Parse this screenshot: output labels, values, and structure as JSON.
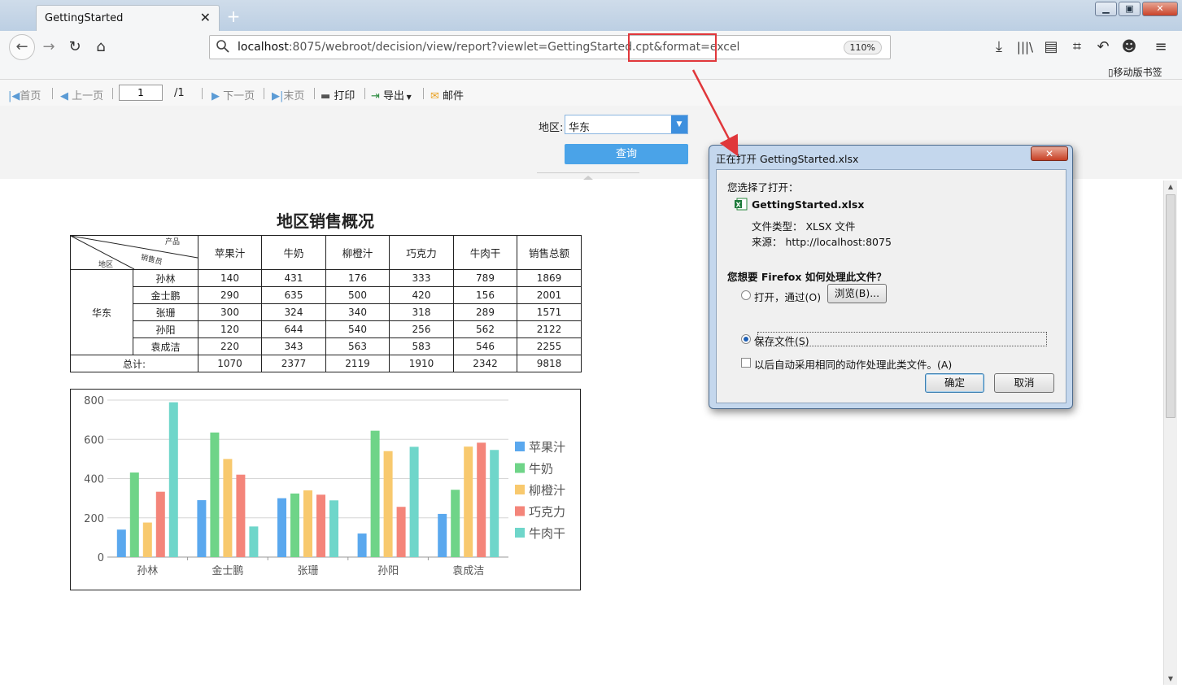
{
  "browser": {
    "tab_title": "GettingStarted",
    "url_host": "localhost",
    "url_rest": ":8075/webroot/decision/view/report?viewlet=GettingStarted.cpt&format=excel",
    "zoom": "110%",
    "mobile_bookmarks": "移动版书签"
  },
  "toolbar": {
    "first": "首页",
    "prev": "上一页",
    "page_value": "1",
    "page_total": "/1",
    "next": "下一页",
    "last": "末页",
    "print": "打印",
    "export": "导出",
    "mail": "邮件"
  },
  "params": {
    "region_label": "地区:",
    "region_value": "华东",
    "query_label": "查询"
  },
  "report": {
    "title": "地区销售概况",
    "corner": {
      "product": "产品",
      "salesperson": "销售员",
      "region": "地区"
    },
    "columns": [
      "苹果汁",
      "牛奶",
      "柳橙汁",
      "巧克力",
      "牛肉干",
      "销售总额"
    ],
    "region": "华东",
    "rows": [
      {
        "name": "孙林",
        "values": [
          "140",
          "431",
          "176",
          "333",
          "789",
          "1869"
        ]
      },
      {
        "name": "金士鹏",
        "values": [
          "290",
          "635",
          "500",
          "420",
          "156",
          "2001"
        ]
      },
      {
        "name": "张珊",
        "values": [
          "300",
          "324",
          "340",
          "318",
          "289",
          "1571"
        ]
      },
      {
        "name": "孙阳",
        "values": [
          "120",
          "644",
          "540",
          "256",
          "562",
          "2122"
        ]
      },
      {
        "name": "袁成洁",
        "values": [
          "220",
          "343",
          "563",
          "583",
          "546",
          "2255"
        ]
      }
    ],
    "total_label": "总计:",
    "totals": [
      "1070",
      "2377",
      "2119",
      "1910",
      "2342",
      "9818"
    ]
  },
  "chart_data": {
    "type": "bar",
    "categories": [
      "孙林",
      "金士鹏",
      "张珊",
      "孙阳",
      "袁成洁"
    ],
    "series": [
      {
        "name": "苹果汁",
        "values": [
          140,
          290,
          300,
          120,
          220
        ],
        "color": "#5aa8ee"
      },
      {
        "name": "牛奶",
        "values": [
          431,
          635,
          324,
          644,
          343
        ],
        "color": "#6fd488"
      },
      {
        "name": "柳橙汁",
        "values": [
          176,
          500,
          340,
          540,
          563
        ],
        "color": "#f8c96e"
      },
      {
        "name": "巧克力",
        "values": [
          333,
          420,
          318,
          256,
          583
        ],
        "color": "#f4857a"
      },
      {
        "name": "牛肉干",
        "values": [
          789,
          156,
          289,
          562,
          546
        ],
        "color": "#6fd6ca"
      }
    ],
    "yticks": [
      0,
      200,
      400,
      600,
      800
    ],
    "ylim": [
      0,
      800
    ],
    "grid": true,
    "legend": "right"
  },
  "dialog": {
    "title": "正在打开 GettingStarted.xlsx",
    "close": "✕",
    "chosen": "您选择了打开：",
    "filename": "GettingStarted.xlsx",
    "filetype": "文件类型：  XLSX 文件",
    "source": "来源：  http://localhost:8075",
    "question": "您想要 Firefox 如何处理此文件？",
    "open_with": "打开，通过(O)",
    "browse": "浏览(B)...",
    "save_file": "保存文件(S)",
    "remember": "以后自动采用相同的动作处理此类文件。(A)",
    "ok": "确定",
    "cancel": "取消"
  }
}
